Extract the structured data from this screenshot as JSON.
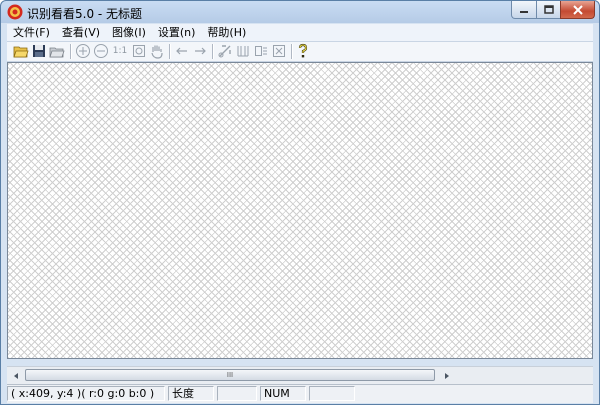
{
  "window": {
    "title": "识别看看5.0 - 无标题"
  },
  "menu": [
    {
      "label": "文件(F)"
    },
    {
      "label": "查看(V)"
    },
    {
      "label": "图像(I)"
    },
    {
      "label": "设置(n)"
    },
    {
      "label": "帮助(H)"
    }
  ],
  "toolbar": {
    "icons": [
      "open-folder-icon",
      "save-icon",
      "open-recent-icon",
      "zoom-in-icon",
      "zoom-out-icon",
      "actual-size-icon",
      "fit-window-icon",
      "hand-pan-icon",
      "arrow-left-icon",
      "arrow-right-icon",
      "crop-icon",
      "text-columns-icon",
      "text-blocks-icon",
      "select-region-icon",
      "help-icon"
    ],
    "actual_size_label": "1:1"
  },
  "scrollbar": {
    "thumb_grip": "III"
  },
  "status": {
    "coords": "( x:409, y:4 )( r:0 g:0 b:0 )",
    "length_label": "长度",
    "num_label": "NUM"
  }
}
